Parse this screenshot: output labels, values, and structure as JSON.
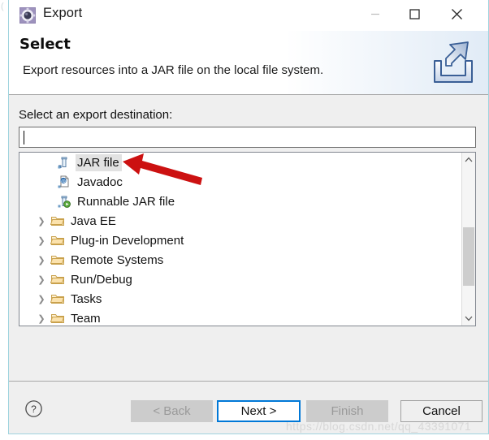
{
  "window": {
    "title": "Export",
    "icon": "export-wizard-icon",
    "controls": {
      "minimize": "—",
      "maximize": "□",
      "close": "✕"
    }
  },
  "header": {
    "title": "Select",
    "description": "Export resources into a JAR file on the local file system.",
    "icon": "export-banner-icon"
  },
  "main": {
    "destination_label": "Select an export destination:",
    "destination_value": "",
    "destination_placeholder": "",
    "tree": [
      {
        "label": "JAR file",
        "icon": "jar-file-icon",
        "type": "leaf",
        "selected": true,
        "expanded": false
      },
      {
        "label": "Javadoc",
        "icon": "javadoc-icon",
        "type": "leaf",
        "selected": false,
        "expanded": false
      },
      {
        "label": "Runnable JAR file",
        "icon": "runnable-jar-file-icon",
        "type": "leaf",
        "selected": false,
        "expanded": false
      },
      {
        "label": "Java EE",
        "icon": "folder-icon",
        "type": "folder",
        "selected": false,
        "expanded": false
      },
      {
        "label": "Plug-in Development",
        "icon": "folder-icon",
        "type": "folder",
        "selected": false,
        "expanded": false
      },
      {
        "label": "Remote Systems",
        "icon": "folder-icon",
        "type": "folder",
        "selected": false,
        "expanded": false
      },
      {
        "label": "Run/Debug",
        "icon": "folder-icon",
        "type": "folder",
        "selected": false,
        "expanded": false
      },
      {
        "label": "Tasks",
        "icon": "folder-icon",
        "type": "folder",
        "selected": false,
        "expanded": false
      },
      {
        "label": "Team",
        "icon": "folder-icon",
        "type": "folder",
        "selected": false,
        "expanded": false
      }
    ],
    "scrollbar": {
      "up_arrow": "⌃",
      "down_arrow": "⌄"
    }
  },
  "footer": {
    "help_label": "?",
    "buttons": [
      {
        "label": "< Back",
        "state": "disabled"
      },
      {
        "label": "Next >",
        "state": "primary"
      },
      {
        "label": "Finish",
        "state": "disabled"
      },
      {
        "label": "Cancel",
        "state": "normal"
      }
    ]
  },
  "annotation": {
    "arrow_color": "#cc1111",
    "points_to": "JAR file"
  },
  "watermark": {
    "text": "https://blog.csdn.net/qq_43391071"
  },
  "colors": {
    "accent": "#0078d7",
    "window_border": "#9fd3de",
    "dialog_bg": "#efefef",
    "selection": "#e2e2e2",
    "folder": "#f5cf80"
  }
}
